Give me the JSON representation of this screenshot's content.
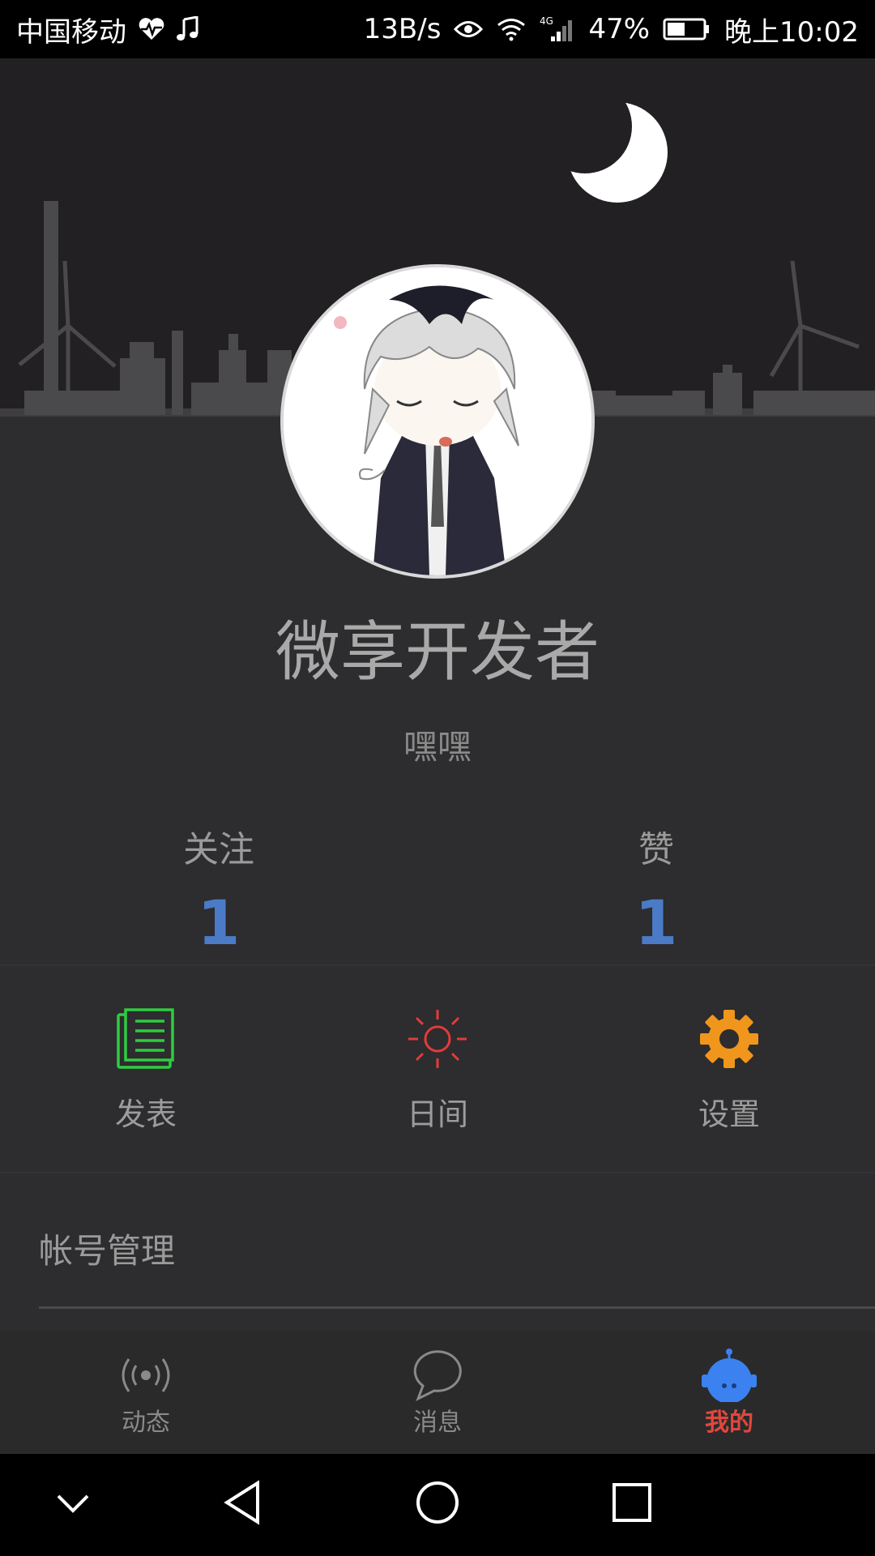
{
  "status_bar": {
    "carrier": "中国移动",
    "net_speed": "13B/s",
    "network_type": "4G",
    "battery": "47%",
    "time": "晚上10:02"
  },
  "profile": {
    "username": "微享开发者",
    "signature": "嘿嘿"
  },
  "stats": [
    {
      "label": "关注",
      "value": "1"
    },
    {
      "label": "赞",
      "value": "1"
    }
  ],
  "actions": [
    {
      "label": "发表",
      "icon": "document-icon",
      "color": "#2ecc40"
    },
    {
      "label": "日间",
      "icon": "sun-icon",
      "color": "#e23b3b"
    },
    {
      "label": "设置",
      "icon": "gear-icon",
      "color": "#f0961c"
    }
  ],
  "account": {
    "label": "帐号管理"
  },
  "tabs": [
    {
      "label": "动态",
      "icon": "broadcast-icon"
    },
    {
      "label": "消息",
      "icon": "chat-bubble-icon"
    },
    {
      "label": "我的",
      "icon": "robot-icon",
      "active": true
    }
  ],
  "colors": {
    "accent_blue": "#4b7bc6",
    "active_tab": "#e0473e"
  }
}
